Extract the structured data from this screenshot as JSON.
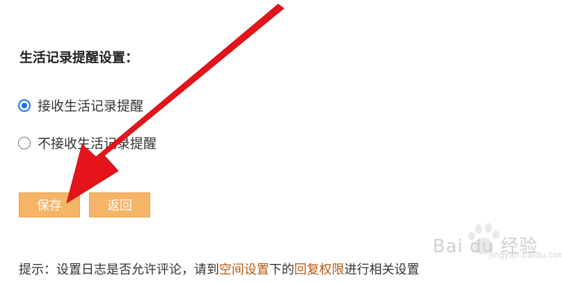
{
  "settings": {
    "title": "生活记录提醒设置：",
    "options": [
      {
        "label": "接收生活记录提醒",
        "checked": true
      },
      {
        "label": "不接收生活记录提醒",
        "checked": false
      }
    ]
  },
  "buttons": {
    "save_label": "保存",
    "back_label": "返回",
    "color": "#f5b466"
  },
  "hint": {
    "prefix": "提示：设置日志是否允许评论，请到",
    "link1": "空间设置",
    "middle": "下的",
    "link2": "回复权限",
    "suffix": "进行相关设置"
  },
  "watermark": {
    "text": "Bai du 经验",
    "sub": "jingyan.baidu.com"
  },
  "annotation": {
    "arrow_color": "#e8141b"
  }
}
